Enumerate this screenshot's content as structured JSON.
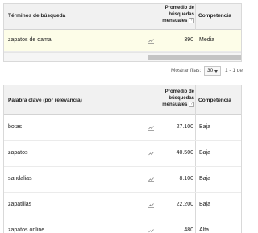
{
  "top_table": {
    "col_term": "Términos de búsqueda",
    "col_avg": "Promedio de búsquedas mensuales",
    "col_help": "?",
    "col_comp": "Competencia",
    "rows": [
      {
        "keyword": "zapatos de dama",
        "trend_icon": "trend-chart-icon",
        "searches": "390",
        "competition": "Media"
      }
    ]
  },
  "pager": {
    "label": "Mostrar filas:",
    "value": "30",
    "range": "1 - 1 de"
  },
  "bottom_table": {
    "col_term": "Palabra clave (por relevancia)",
    "col_avg": "Promedio de búsquedas mensuales",
    "col_help": "?",
    "col_comp": "Competencia",
    "rows": [
      {
        "keyword": "botas",
        "trend_icon": "trend-chart-icon",
        "searches": "27.100",
        "competition": "Baja"
      },
      {
        "keyword": "zapatos",
        "trend_icon": "trend-chart-icon",
        "searches": "40.500",
        "competition": "Baja"
      },
      {
        "keyword": "sandalias",
        "trend_icon": "trend-chart-icon",
        "searches": "8.100",
        "competition": "Baja"
      },
      {
        "keyword": "zapatillas",
        "trend_icon": "trend-chart-icon",
        "searches": "22.200",
        "competition": "Baja"
      },
      {
        "keyword": "zapatos online",
        "trend_icon": "trend-chart-icon",
        "searches": "480",
        "competition": "Alta"
      }
    ]
  },
  "colors": {
    "header_bg": "#f1f1f1",
    "highlight_row_bg": "#fdfde8",
    "border": "#d9d9d9"
  }
}
